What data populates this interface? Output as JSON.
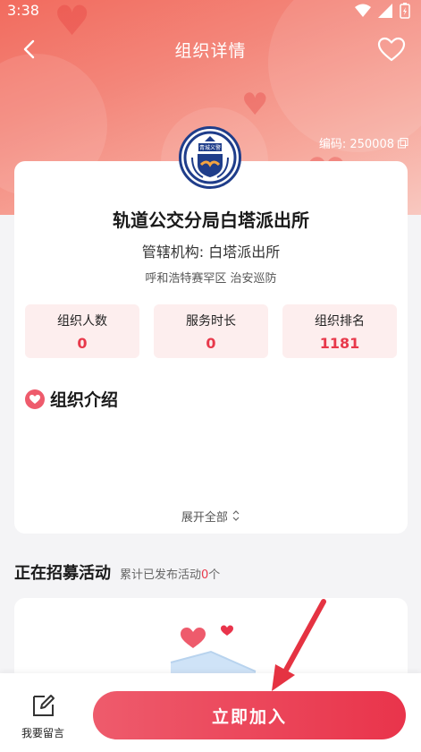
{
  "status_bar": {
    "time": "3:38"
  },
  "nav": {
    "title": "组织详情"
  },
  "org": {
    "code_label": "编码: 250008",
    "name": "轨道公交分局白塔派出所",
    "admin": "管辖机构: 白塔派出所",
    "tags": "呼和浩特赛罕区 治安巡防",
    "logo_text": "青城义警"
  },
  "stats": [
    {
      "label": "组织人数",
      "value": "0"
    },
    {
      "label": "服务时长",
      "value": "0"
    },
    {
      "label": "组织排名",
      "value": "1181"
    }
  ],
  "intro": {
    "title": "组织介绍",
    "expand_label": "展开全部"
  },
  "recruit": {
    "title": "正在招募活动",
    "sub_prefix": "累计已发布活动",
    "count": "0",
    "sub_suffix": "个"
  },
  "bottom": {
    "message_label": "我要留言",
    "join_label": "立即加入"
  },
  "colors": {
    "accent": "#e8394b",
    "stat_bg": "#fdeeee"
  }
}
